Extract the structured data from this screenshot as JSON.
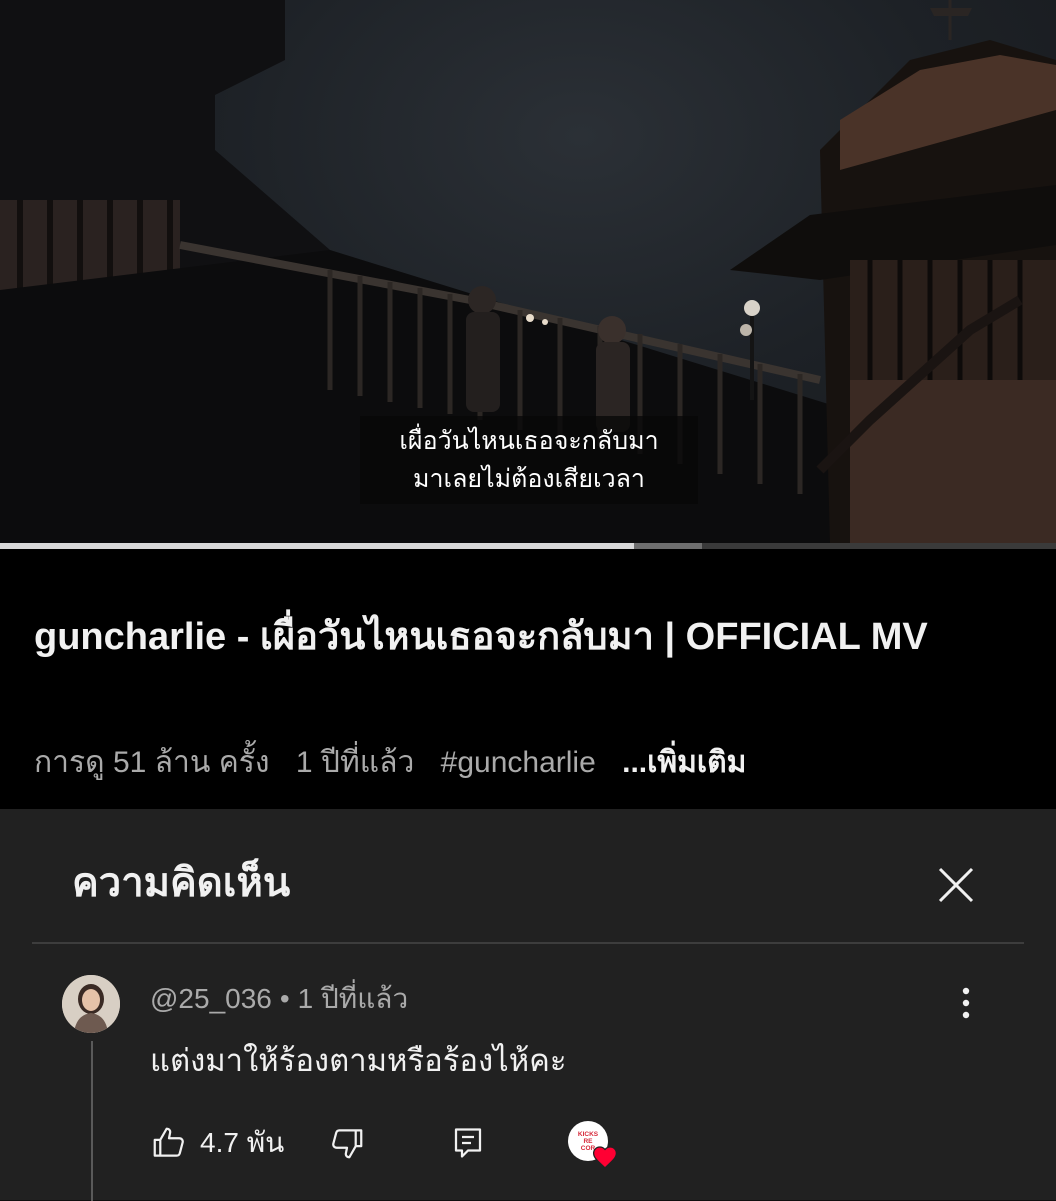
{
  "video": {
    "subtitle_lines": [
      "เผื่อวันไหนเธอจะกลับมา",
      "มาเลยไม่ต้องเสียเวลา"
    ],
    "progress": {
      "played_fraction": 0.6,
      "buffered_fraction": 0.665
    }
  },
  "info": {
    "title": "guncharlie - เผื่อวันไหนเธอจะกลับมา | OFFICIAL MV",
    "views": "การดู 51 ล้าน ครั้ง",
    "age": "1 ปีที่แล้ว",
    "hashtag": "#guncharlie",
    "more": "...เพิ่มเติม"
  },
  "comments": {
    "header": "ความคิดเห็น",
    "close_icon": "close-icon",
    "items": [
      {
        "author": "@25_036",
        "separator": "•",
        "time": "1 ปีที่แล้ว",
        "text": "แต่งมาให้ร้องตามหรือร้องไห้คะ",
        "likes": "4.7 พัน",
        "creator_heart": {
          "logo_lines": [
            "KICKS",
            "RE",
            "COR"
          ],
          "heart_color": "#ff0033"
        }
      }
    ]
  },
  "colors": {
    "background": "#0f0f0f",
    "panel": "#212121",
    "secondary_text": "#aaaaaa",
    "heart": "#ff0033"
  }
}
